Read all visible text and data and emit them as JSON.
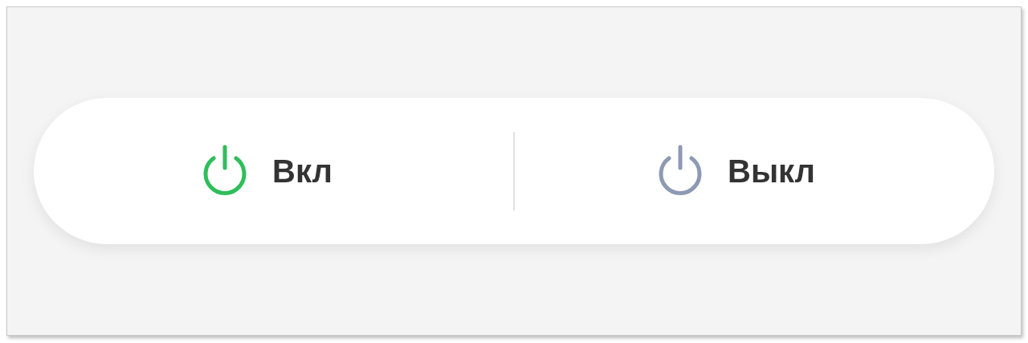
{
  "power_toggle": {
    "options": [
      {
        "label": "Вкл",
        "selected": true
      },
      {
        "label": "Выкл",
        "selected": false
      }
    ]
  }
}
